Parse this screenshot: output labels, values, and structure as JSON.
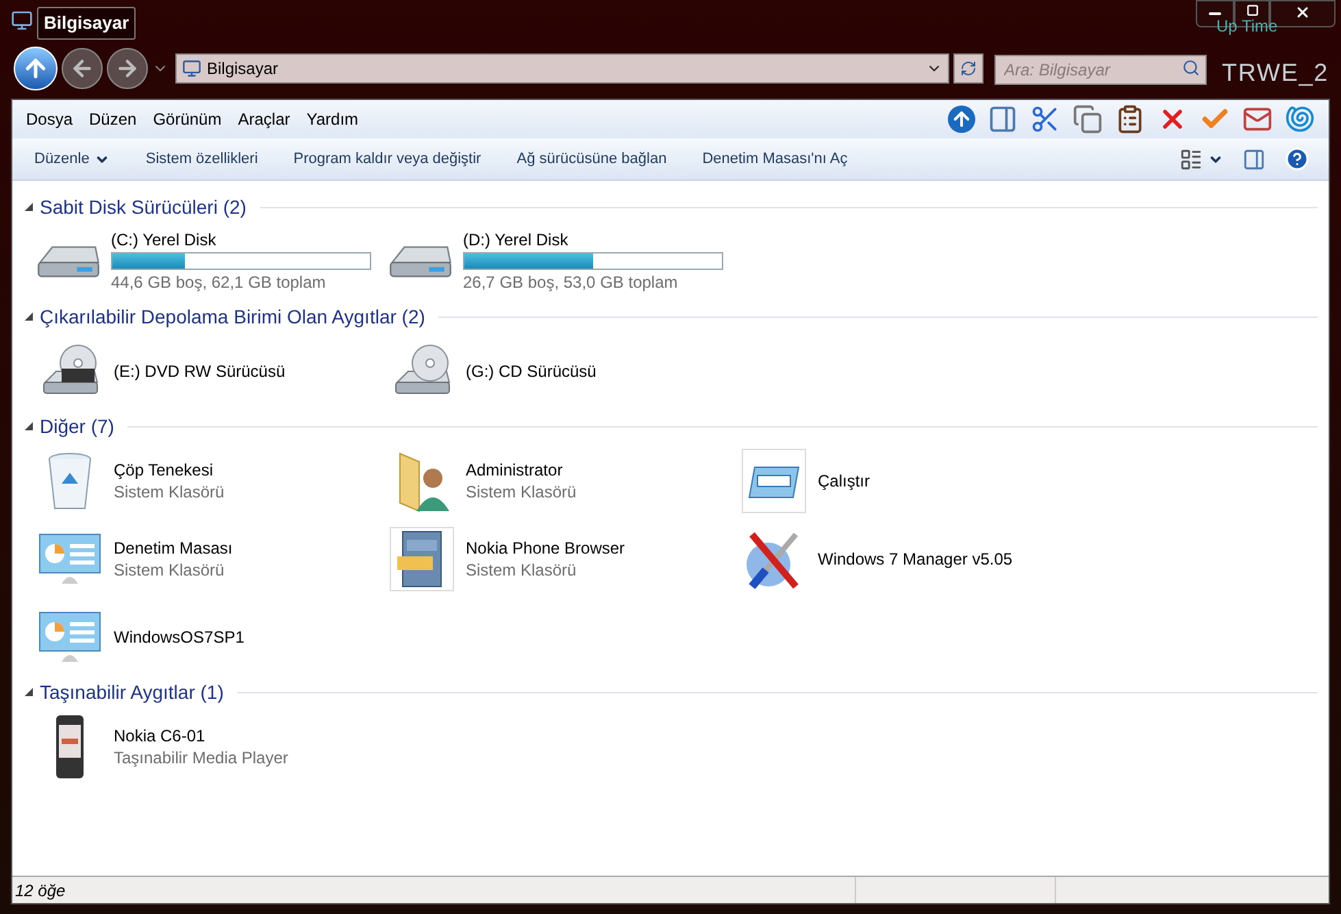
{
  "window": {
    "title": "Bilgisayar"
  },
  "desktop_overlay": [
    "Up Time",
    "TRWE_2"
  ],
  "address": {
    "value": "Bilgisayar"
  },
  "search": {
    "placeholder": "Ara: Bilgisayar"
  },
  "menu": [
    "Dosya",
    "Düzen",
    "Görünüm",
    "Araçlar",
    "Yardım"
  ],
  "commands": [
    {
      "label": "Düzenle",
      "dropdown": true
    },
    {
      "label": "Sistem özellikleri",
      "dropdown": false
    },
    {
      "label": "Program kaldır veya değiştir",
      "dropdown": false
    },
    {
      "label": "Ağ sürücüsüne bağlan",
      "dropdown": false
    },
    {
      "label": "Denetim Masası'nı Aç",
      "dropdown": false
    }
  ],
  "groups": [
    {
      "title": "Sabit Disk Sürücüleri (2)",
      "expanded": true,
      "items": [
        {
          "kind": "harddisk",
          "name": "(C:) Yerel Disk",
          "level": 0.28,
          "detail": "44,6 GB boş, 62,1 GB toplam"
        },
        {
          "kind": "harddisk",
          "name": "(D:) Yerel Disk",
          "level": 0.5,
          "detail": "26,7 GB boş, 53,0 GB toplam"
        }
      ]
    },
    {
      "title": "Çıkarılabilir Depolama Birimi Olan Aygıtlar (2)",
      "expanded": true,
      "items": [
        {
          "kind": "dvd",
          "name": "(E:) DVD RW Sürücüsü"
        },
        {
          "kind": "cd",
          "name": "(G:) CD Sürücüsü"
        }
      ]
    },
    {
      "title": "Diğer (7)",
      "expanded": true,
      "items": [
        {
          "kind": "trash",
          "name": "Çöp Tenekesi",
          "detail": "Sistem Klasörü"
        },
        {
          "kind": "userfolder",
          "name": "Administrator",
          "detail": "Sistem Klasörü"
        },
        {
          "kind": "run",
          "name": "Çalıştır"
        },
        {
          "kind": "controlpanel",
          "name": "Denetim Masası",
          "detail": "Sistem Klasörü"
        },
        {
          "kind": "cabinet",
          "name": "Nokia Phone Browser",
          "detail": "Sistem Klasörü"
        },
        {
          "kind": "tools",
          "name": "Windows 7 Manager v5.05"
        },
        {
          "kind": "controlpanel",
          "name": "WindowsOS7SP1"
        }
      ]
    },
    {
      "title": "Taşınabilir Aygıtlar (1)",
      "expanded": true,
      "items": [
        {
          "kind": "phone",
          "name": "Nokia C6-01",
          "detail": "Taşınabilir Media Player"
        }
      ]
    }
  ],
  "status_bar": {
    "text": "12 öğe"
  }
}
